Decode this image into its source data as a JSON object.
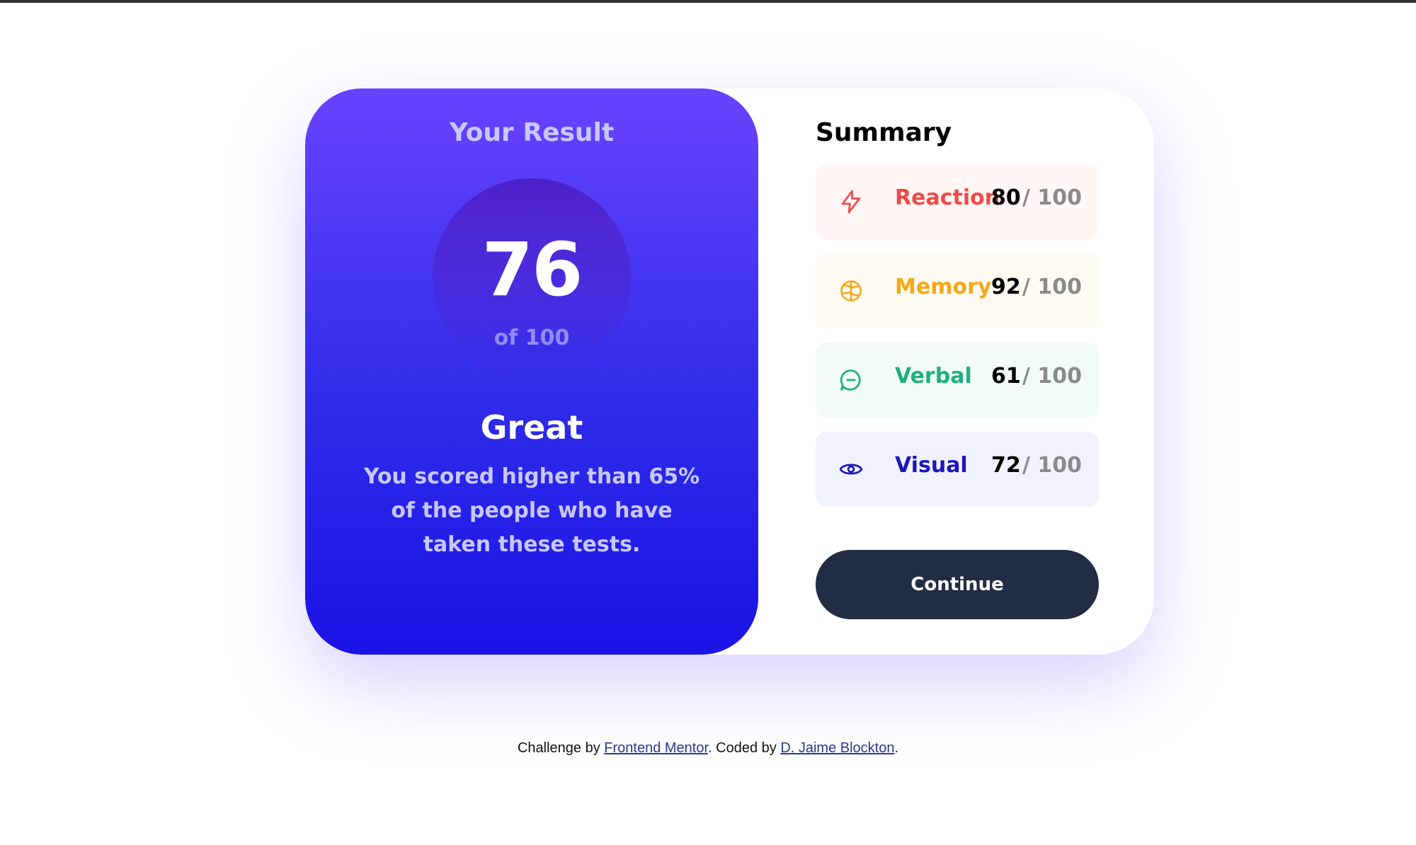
{
  "result": {
    "title": "Your Result",
    "score": "76",
    "score_max": "of 100",
    "rating": "Great",
    "description": "You scored higher than 65% of the people who have taken these tests."
  },
  "summary": {
    "title": "Summary",
    "max_label": "/ 100",
    "items": [
      {
        "label": "Reaction",
        "score": "80",
        "icon": "lightning-icon",
        "color": "#f04a4a",
        "bg": "#fff6f5"
      },
      {
        "label": "Memory",
        "score": "92",
        "icon": "brain-icon",
        "color": "#f5a817",
        "bg": "#fffbf3"
      },
      {
        "label": "Verbal",
        "score": "61",
        "icon": "chat-bubble-icon",
        "color": "#1fb080",
        "bg": "#f2fbf8"
      },
      {
        "label": "Visual",
        "score": "72",
        "icon": "eye-icon",
        "color": "#1b16b8",
        "bg": "#f2f2fd"
      }
    ],
    "continue_label": "Continue"
  },
  "footer": {
    "prefix": "Challenge by ",
    "link1": "Frontend Mentor",
    "middle": ". Coded by ",
    "link2": "D. Jaime Blockton",
    "suffix": "."
  }
}
